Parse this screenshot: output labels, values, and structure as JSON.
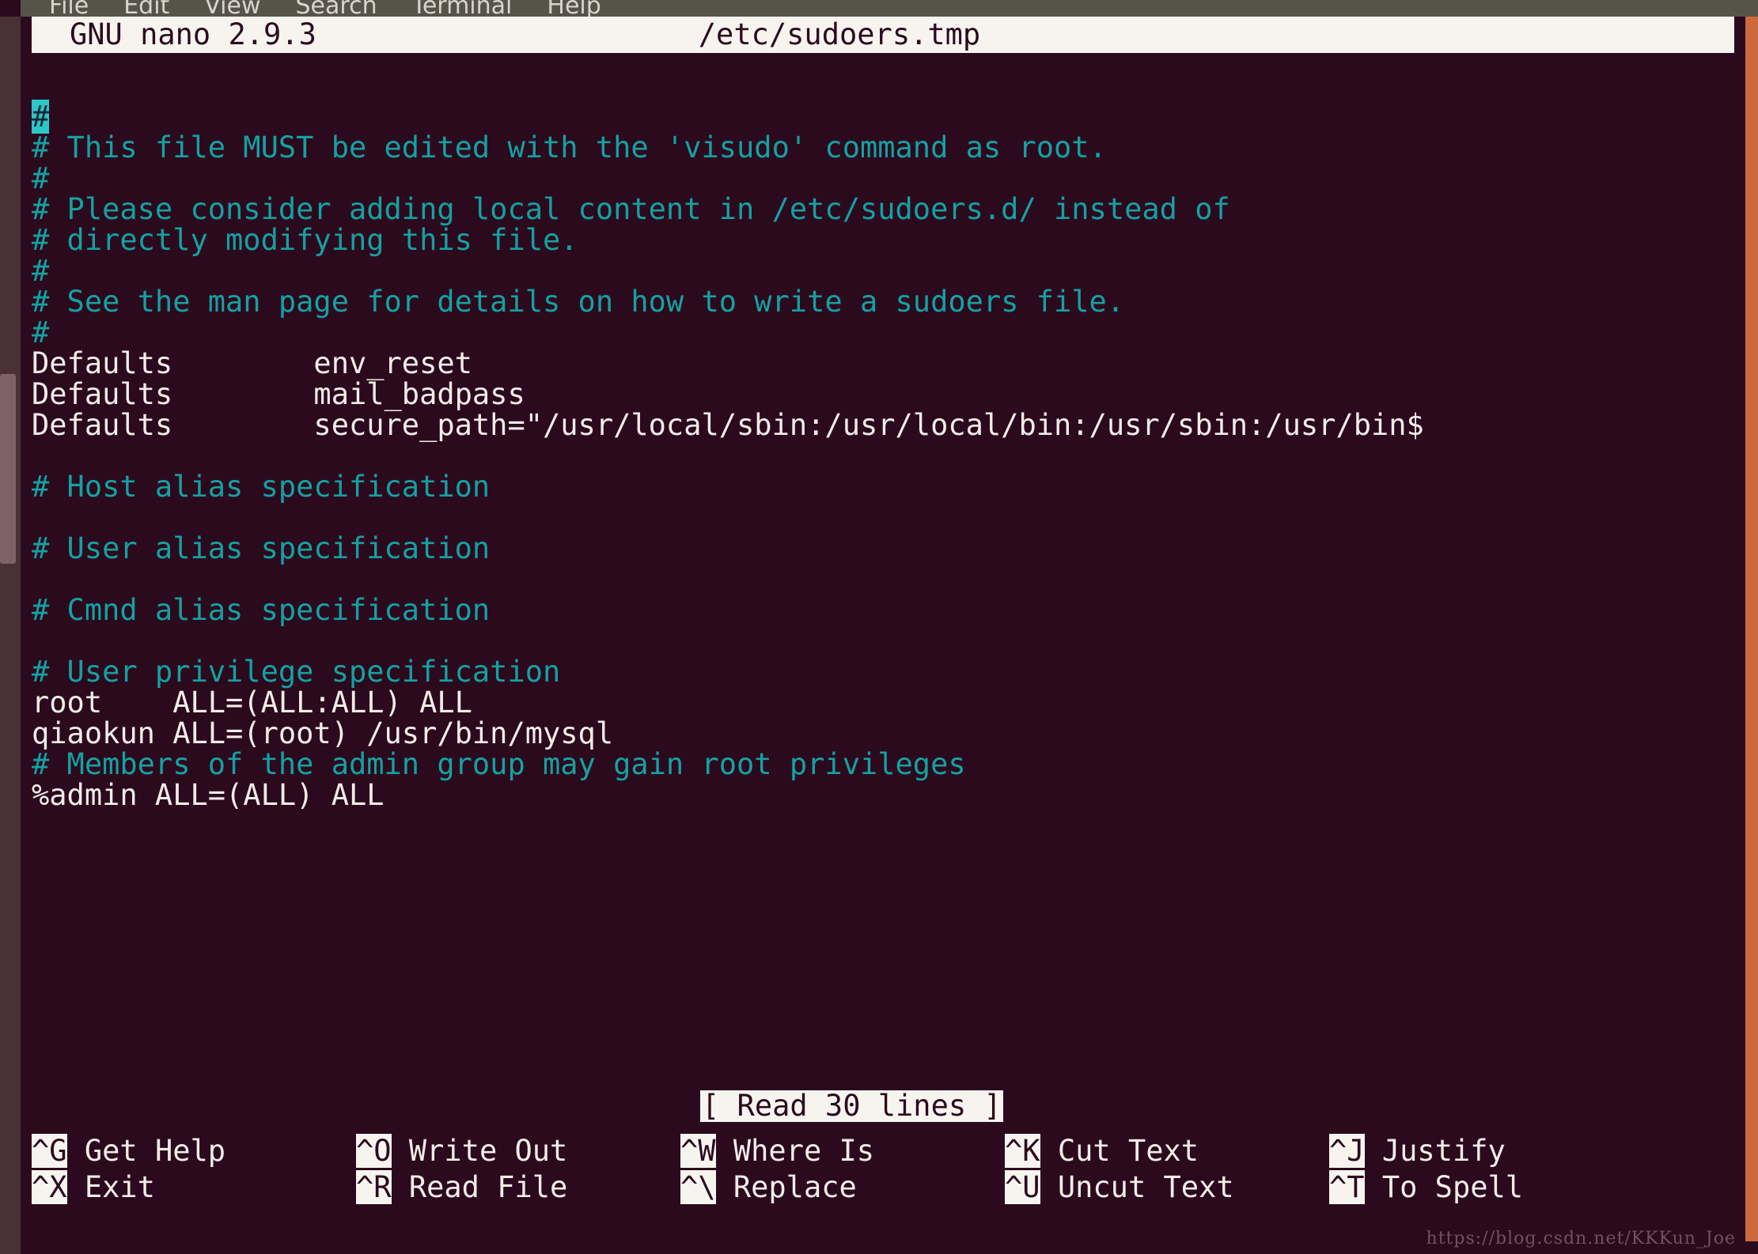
{
  "window": {
    "menu_items": [
      "File",
      "Edit",
      "View",
      "Search",
      "Terminal",
      "Help"
    ],
    "colors": {
      "terminal_background": "#2c0a1e",
      "menu_background": "#565449",
      "comment_text": "#14a1a1",
      "normal_text": "#f2ece8",
      "inverted_background": "#f7f4f0",
      "inverted_text": "#2c0a1e",
      "cursor_block": "#2bc7c7",
      "scrollbar_right": "#cd6a3c",
      "window_frame": "#4a3136",
      "scrollbar_left_thumb": "#7d6269"
    }
  },
  "nano": {
    "version_label": "GNU nano 2.9.3",
    "filename": "/etc/sudoers.tmp",
    "status_message": "[ Read 30 lines ]",
    "cursor_char": "#",
    "continuation_marker": "$",
    "lines": [
      {
        "text": "",
        "type": "blank"
      },
      {
        "text": "#",
        "type": "comment",
        "cursor": true
      },
      {
        "text": "# This file MUST be edited with the 'visudo' command as root.",
        "type": "comment"
      },
      {
        "text": "#",
        "type": "comment"
      },
      {
        "text": "# Please consider adding local content in /etc/sudoers.d/ instead of",
        "type": "comment"
      },
      {
        "text": "# directly modifying this file.",
        "type": "comment"
      },
      {
        "text": "#",
        "type": "comment"
      },
      {
        "text": "# See the man page for details on how to write a sudoers file.",
        "type": "comment"
      },
      {
        "text": "#",
        "type": "comment"
      },
      {
        "text": "Defaults        env_reset",
        "type": "normal"
      },
      {
        "text": "Defaults        mail_badpass",
        "type": "normal"
      },
      {
        "text": "Defaults        secure_path=\"/usr/local/sbin:/usr/local/bin:/usr/sbin:/usr/bin",
        "type": "normal",
        "continued": true
      },
      {
        "text": "",
        "type": "blank"
      },
      {
        "text": "# Host alias specification",
        "type": "comment"
      },
      {
        "text": "",
        "type": "blank"
      },
      {
        "text": "# User alias specification",
        "type": "comment"
      },
      {
        "text": "",
        "type": "blank"
      },
      {
        "text": "# Cmnd alias specification",
        "type": "comment"
      },
      {
        "text": "",
        "type": "blank"
      },
      {
        "text": "# User privilege specification",
        "type": "comment"
      },
      {
        "text": "root    ALL=(ALL:ALL) ALL",
        "type": "normal"
      },
      {
        "text": "qiaokun ALL=(root) /usr/bin/mysql",
        "type": "normal"
      },
      {
        "text": "# Members of the admin group may gain root privileges",
        "type": "comment"
      },
      {
        "text": "%admin ALL=(ALL) ALL",
        "type": "normal"
      }
    ],
    "shortcuts_row1": [
      {
        "key": "^G",
        "label": " Get Help"
      },
      {
        "key": "^O",
        "label": " Write Out"
      },
      {
        "key": "^W",
        "label": " Where Is"
      },
      {
        "key": "^K",
        "label": " Cut Text"
      },
      {
        "key": "^J",
        "label": " Justify"
      }
    ],
    "shortcuts_row2": [
      {
        "key": "^X",
        "label": " Exit"
      },
      {
        "key": "^R",
        "label": " Read File"
      },
      {
        "key": "^\\",
        "label": " Replace"
      },
      {
        "key": "^U",
        "label": " Uncut Text"
      },
      {
        "key": "^T",
        "label": " To Spell"
      }
    ]
  },
  "watermark": "https://blog.csdn.net/KKKun_Joe"
}
